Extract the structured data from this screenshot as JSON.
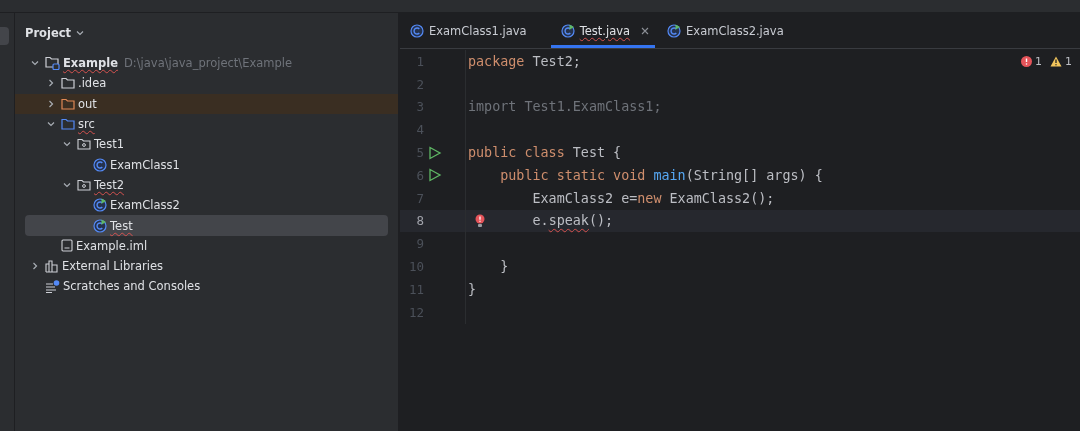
{
  "project_panel": {
    "title": "Project",
    "tree": [
      {
        "label": "Example",
        "hint": "D:\\java\\java_project\\Example",
        "kind": "project",
        "expanded": true,
        "selected": false,
        "typo": true,
        "children": [
          {
            "label": ".idea",
            "kind": "folder",
            "expanded": false,
            "selected": false,
            "typo": false
          },
          {
            "label": "out",
            "kind": "excluded-folder",
            "expanded": false,
            "selected": false,
            "typo": false
          },
          {
            "label": "src",
            "kind": "source-folder",
            "expanded": true,
            "selected": false,
            "typo": true,
            "children": [
              {
                "label": "Test1",
                "kind": "package",
                "expanded": true,
                "selected": false,
                "typo": false,
                "children": [
                  {
                    "label": "ExamClass1",
                    "kind": "class",
                    "selected": false,
                    "typo": false
                  }
                ]
              },
              {
                "label": "Test2",
                "kind": "package",
                "expanded": true,
                "selected": false,
                "typo": true,
                "children": [
                  {
                    "label": "ExamClass2",
                    "kind": "runnable-class",
                    "selected": false,
                    "typo": false
                  },
                  {
                    "label": "Test",
                    "kind": "runnable-class",
                    "selected": true,
                    "typo": true
                  }
                ]
              }
            ]
          },
          {
            "label": "Example.iml",
            "kind": "file",
            "selected": false,
            "typo": false
          }
        ]
      },
      {
        "label": "External Libraries",
        "kind": "libraries",
        "expanded": false,
        "selected": false,
        "typo": false
      },
      {
        "label": "Scratches and Consoles",
        "kind": "scratches",
        "selected": false,
        "typo": false
      }
    ]
  },
  "editor": {
    "tabs": [
      {
        "label": "ExamClass1.java",
        "kind": "class",
        "selected": false,
        "typo": false
      },
      {
        "label": "Test.java",
        "kind": "runnable-class",
        "selected": true,
        "typo": true
      },
      {
        "label": "ExamClass2.java",
        "kind": "runnable-class",
        "selected": false,
        "typo": false
      }
    ],
    "inspections": {
      "errors": "1",
      "warnings": "1"
    },
    "lines": [
      {
        "number": "1",
        "current": false,
        "run": false,
        "bulb": false,
        "tokens": [
          {
            "text": "package",
            "kind": "keyword"
          },
          {
            "text": " Test2;",
            "kind": "plain"
          }
        ]
      },
      {
        "number": "2",
        "current": false,
        "run": false,
        "bulb": false
      },
      {
        "number": "3",
        "current": false,
        "run": false,
        "bulb": false,
        "tokens": [
          {
            "text": "import Test1.ExamClass1;",
            "kind": "unused"
          }
        ]
      },
      {
        "number": "4",
        "current": false,
        "run": false,
        "bulb": false
      },
      {
        "number": "5",
        "current": false,
        "run": true,
        "bulb": false,
        "tokens": [
          {
            "text": "public class",
            "kind": "keyword"
          },
          {
            "text": " Test {",
            "kind": "plain"
          }
        ]
      },
      {
        "number": "6",
        "current": false,
        "run": true,
        "bulb": false,
        "tokens": [
          {
            "text": "    public static void ",
            "kind": "keyword"
          },
          {
            "text": "main",
            "kind": "method"
          },
          {
            "text": "(String[] args) {",
            "kind": "plain"
          }
        ]
      },
      {
        "number": "7",
        "current": false,
        "run": false,
        "bulb": false,
        "tokens": [
          {
            "text": "        ExamClass2 e=",
            "kind": "plain"
          },
          {
            "text": "new",
            "kind": "keyword"
          },
          {
            "text": " ExamClass2();",
            "kind": "plain"
          }
        ]
      },
      {
        "number": "8",
        "current": true,
        "run": false,
        "bulb": true,
        "tokens": [
          {
            "text": "        e.",
            "kind": "plain"
          },
          {
            "text": "speak",
            "kind": "error"
          },
          {
            "text": "();",
            "kind": "plain"
          }
        ]
      },
      {
        "number": "9",
        "current": false,
        "run": false,
        "bulb": false
      },
      {
        "number": "10",
        "current": false,
        "run": false,
        "bulb": false,
        "tokens": [
          {
            "text": "    }",
            "kind": "plain"
          }
        ]
      },
      {
        "number": "11",
        "current": false,
        "run": false,
        "bulb": false,
        "tokens": [
          {
            "text": "}",
            "kind": "plain"
          }
        ]
      },
      {
        "number": "12",
        "current": false,
        "run": false,
        "bulb": false
      }
    ]
  }
}
